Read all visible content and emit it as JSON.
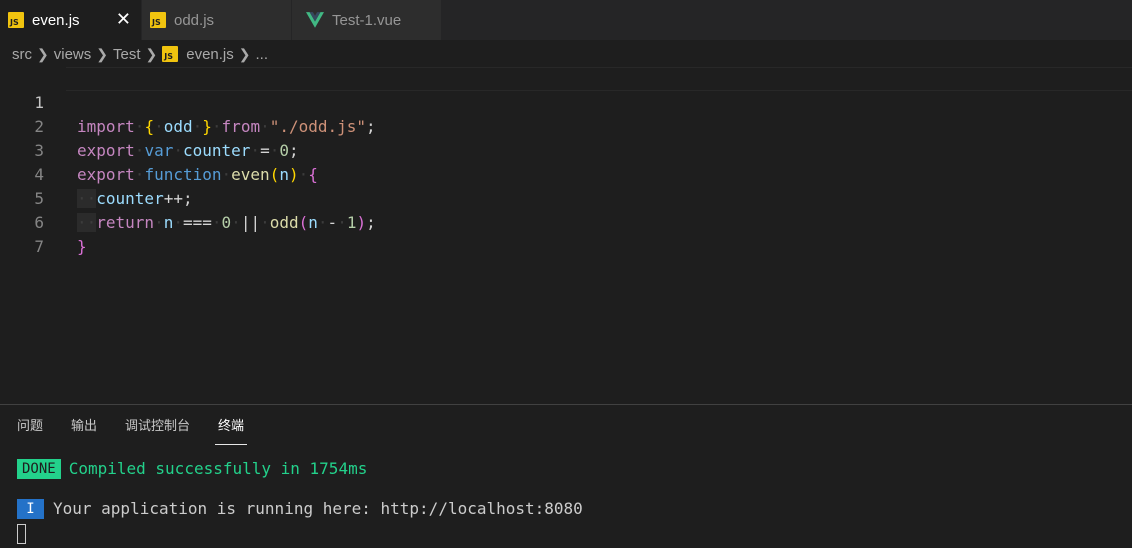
{
  "tabs": [
    {
      "label": "even.js",
      "icon": "js-file-icon",
      "active": true,
      "close": "✕"
    },
    {
      "label": "odd.js",
      "icon": "js-file-icon",
      "active": false
    },
    {
      "label": "Test-1.vue",
      "icon": "vue-file-icon",
      "active": false
    }
  ],
  "breadcrumb": {
    "items": [
      "src",
      "views",
      "Test",
      "even.js",
      "..."
    ]
  },
  "editor": {
    "line_numbers": [
      "1",
      "2",
      "3",
      "4",
      "5",
      "6",
      "7"
    ],
    "current_line": 1
  },
  "panel": {
    "tabs": [
      "问题",
      "输出",
      "调试控制台",
      "终端"
    ],
    "active_tab": "终端"
  },
  "terminal": {
    "done_badge": "DONE",
    "compiled_text": "Compiled successfully in 1754ms",
    "info_badge": "I",
    "running_text": "Your application is running here: http://localhost:8080"
  },
  "colors": {
    "background": "#1e1e1e",
    "tab_bar": "#252526",
    "success_green": "#23d18b",
    "info_blue": "#2472c8",
    "js_yellow": "#f1c40f",
    "vue_green": "#41b883"
  }
}
